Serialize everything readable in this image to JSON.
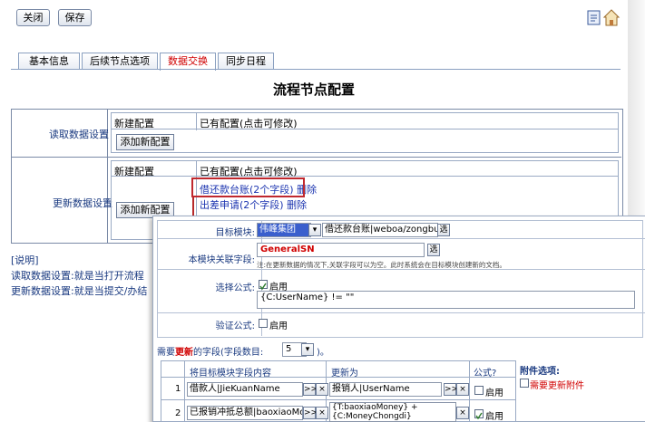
{
  "toolbar": {
    "close_label": "关闭",
    "save_label": "保存"
  },
  "tabs": [
    {
      "label": "基本信息"
    },
    {
      "label": "后续节点选项"
    },
    {
      "label": "数据交换"
    },
    {
      "label": "同步日程"
    }
  ],
  "page_title": "流程节点配置",
  "read_section": {
    "label": "读取数据设置",
    "new_config": "新建配置",
    "existing_config": "已有配置(点击可修改)",
    "add_button": "添加新配置"
  },
  "update_section": {
    "label": "更新数据设置",
    "new_config": "新建配置",
    "existing_config": "已有配置(点击可修改)",
    "add_button": "添加新配置",
    "configs": [
      {
        "name": "借还款台账(2个字段)",
        "delete": "删除"
      },
      {
        "name": "出差申请(2个字段)",
        "delete": "删除"
      }
    ]
  },
  "notes": {
    "heading": "[说明]",
    "line1": "读取数据设置:就是当打开流程",
    "line2": "更新数据设置:就是当提交/办结"
  },
  "popup": {
    "target_module_label": "目标模块:",
    "target_group": "伟峰集团",
    "target_module_value": "借还款台账|weboa/zongbu/jiekua",
    "key_field_label": "本模块关联字段:",
    "key_field_value": "GeneralSN",
    "key_field_note": "注:在更新数据的情况下,关联字段可以为空。此时系统会在目标模块创建新的文档。",
    "select_formula_label": "选择公式:",
    "enable_label": "启用",
    "formula_value": "{C:UserName} != \"\"",
    "verify_formula_label": "验证公式:",
    "verify_enable_label": "启用",
    "fields_heading_prefix": "需要",
    "fields_heading_highlight": "更新",
    "fields_heading_suffix": "的字段(字段数目:",
    "field_count": "5",
    "fields_heading_end": ")。",
    "columns": {
      "target": "将目标模块字段内容",
      "update_to": "更新为",
      "formula": "公式?"
    },
    "rows": [
      {
        "index": "1",
        "target": "借款人|JieKuanName",
        "update_to": "报销人|UserName",
        "formula_enable": "启用",
        "formula_checked": false
      },
      {
        "index": "2",
        "target": "已报销冲抵总额|baoxiaoMoney",
        "update_to": "{T:baoxiaoMoney} + {C:MoneyChongdi}",
        "formula_enable": "启用",
        "formula_checked": true
      }
    ],
    "attachment_heading": "附件选项:",
    "attachment_option": "需要更新附件",
    "move_btn": ">>",
    "clear_btn": "×",
    "pick_btn": "选"
  }
}
